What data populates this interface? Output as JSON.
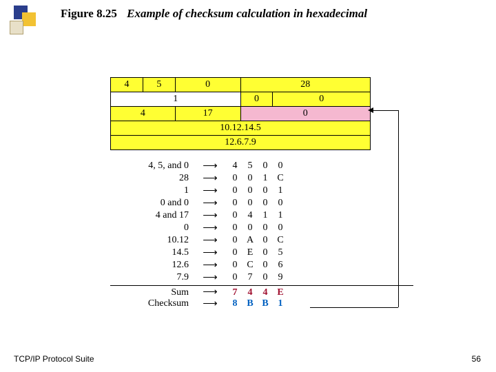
{
  "title": {
    "label": "Figure 8.25",
    "caption": "Example of checksum calculation in hexadecimal"
  },
  "header_table": {
    "row1": {
      "c1": "4",
      "c2": "5",
      "c3": "0",
      "c4": "28"
    },
    "row2": {
      "c1": "1",
      "c2": "0",
      "c3": "0"
    },
    "row3": {
      "c1": "4",
      "c2": "17",
      "c3": "0"
    },
    "row4": "10.12.14.5",
    "row5": "12.6.7.9"
  },
  "calc_rows": [
    {
      "label": "4, 5, and 0",
      "h": [
        "4",
        "5",
        "0",
        "0"
      ]
    },
    {
      "label": "28",
      "h": [
        "0",
        "0",
        "1",
        "C"
      ]
    },
    {
      "label": "1",
      "h": [
        "0",
        "0",
        "0",
        "1"
      ]
    },
    {
      "label": "0 and 0",
      "h": [
        "0",
        "0",
        "0",
        "0"
      ]
    },
    {
      "label": "4 and 17",
      "h": [
        "0",
        "4",
        "1",
        "1"
      ]
    },
    {
      "label": "0",
      "h": [
        "0",
        "0",
        "0",
        "0"
      ]
    },
    {
      "label": "10.12",
      "h": [
        "0",
        "A",
        "0",
        "C"
      ]
    },
    {
      "label": "14.5",
      "h": [
        "0",
        "E",
        "0",
        "5"
      ]
    },
    {
      "label": "12.6",
      "h": [
        "0",
        "C",
        "0",
        "6"
      ]
    },
    {
      "label": "7.9",
      "h": [
        "0",
        "7",
        "0",
        "9"
      ]
    }
  ],
  "sum": {
    "label": "Sum",
    "h": [
      "7",
      "4",
      "4",
      "E"
    ]
  },
  "checksum": {
    "label": "Checksum",
    "h": [
      "8",
      "B",
      "B",
      "1"
    ]
  },
  "footer": {
    "left": "TCP/IP Protocol Suite",
    "right": "56"
  },
  "chart_data": {
    "type": "table",
    "title": "IP header checksum calculation (hexadecimal)",
    "header_fields": {
      "version": 4,
      "hlen": 5,
      "service": 0,
      "total_length": 28,
      "identification": 1,
      "flags_frag": [
        0,
        0
      ],
      "ttl": 4,
      "protocol": 17,
      "checksum_in": 0,
      "src_ip": "10.12.14.5",
      "dst_ip": "12.6.7.9"
    },
    "hex_words": [
      "4500",
      "001C",
      "0001",
      "0000",
      "0411",
      "0000",
      "0A0C",
      "0E05",
      "0C06",
      "0709"
    ],
    "sum_hex": "744E",
    "checksum_hex": "8BB1"
  }
}
